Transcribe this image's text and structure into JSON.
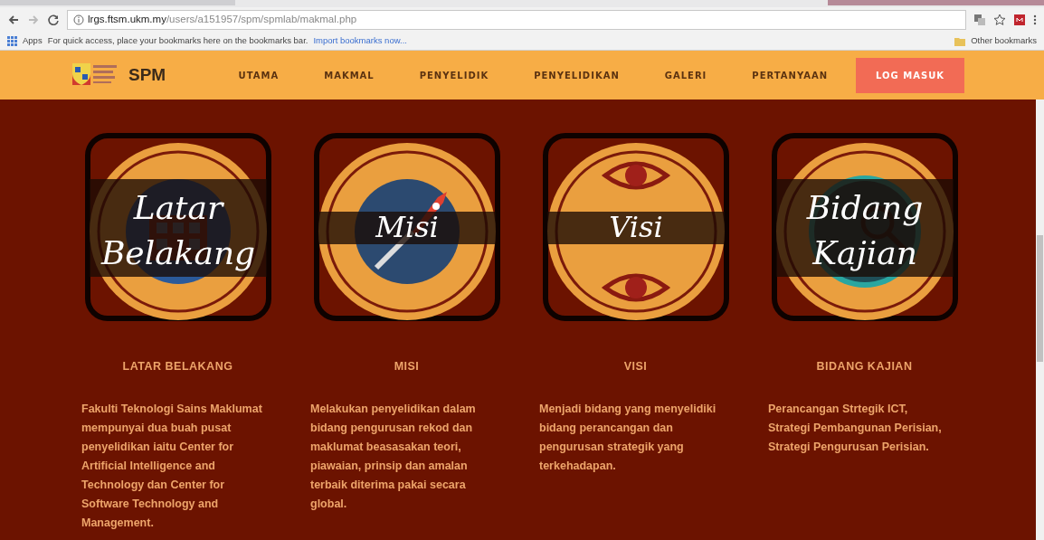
{
  "browser": {
    "url_host": "lrgs.ftsm.ukm.my",
    "url_path": "/users/a151957/spm/spmlab/makmal.php",
    "bookmarks_apps": "Apps",
    "bookmarks_hint": "For quick access, place your bookmarks here on the bookmarks bar.",
    "bookmarks_import": "Import bookmarks now...",
    "other_bookmarks": "Other bookmarks"
  },
  "navbar": {
    "brand": "SPM",
    "links": [
      {
        "label": "UTAMA",
        "kind": "link"
      },
      {
        "label": "MAKMAL",
        "kind": "link"
      },
      {
        "label": "PENYELIDIK",
        "kind": "link"
      },
      {
        "label": "PENYELIDIKAN",
        "kind": "link"
      },
      {
        "label": "GALERI",
        "kind": "link"
      },
      {
        "label": "PERTANYAAN",
        "kind": "link"
      },
      {
        "label": "LOG MASUK",
        "kind": "button"
      }
    ]
  },
  "sections": [
    {
      "image_title": [
        "Latar",
        "Belakang"
      ],
      "heading": "LATAR BELAKANG",
      "text": "Fakulti Teknologi Sains Maklumat mempunyai dua buah pusat penyelidikan iaitu Center for Artificial Intelligence and Technology dan Center for Software Technology and Management."
    },
    {
      "image_title": [
        "Misi"
      ],
      "heading": "MISI",
      "text": "Melakukan penyelidikan dalam bidang pengurusan rekod dan maklumat beasasakan teori, piawaian, prinsip dan amalan terbaik diterima pakai secara global."
    },
    {
      "image_title": [
        "Visi"
      ],
      "heading": "VISI",
      "text": "Menjadi bidang yang  menyelidiki bidang perancangan dan pengurusan strategik yang terkehadapan."
    },
    {
      "image_title": [
        "Bidang",
        "Kajian"
      ],
      "heading": "BIDANG KAJIAN",
      "text": "Perancangan Strtegik ICT, Strategi Pembangunan Perisian, Strategi Pengurusan Perisian."
    }
  ]
}
